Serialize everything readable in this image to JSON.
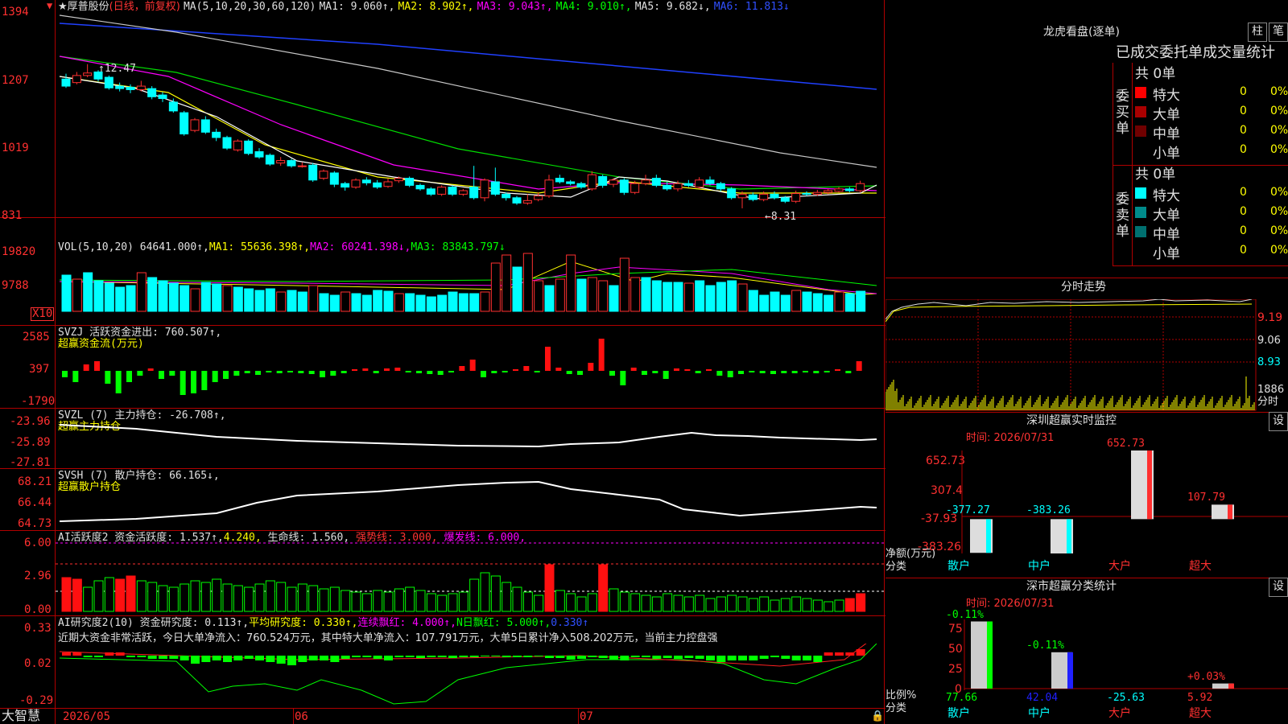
{
  "top_icon": "settings-marker-icon",
  "main": {
    "star_icon": "star-icon",
    "stock_name": "厚普股份",
    "mode": "(日线，前复权)",
    "ma_label": "MA(5,10,20,30,60,120)",
    "ma1": "MA1: 9.060↑,",
    "ma2": "MA2: 8.902↑,",
    "ma3": "MA3: 9.043↑,",
    "ma4": "MA4: 9.010↑,",
    "ma5": "MA5: 9.682↓,",
    "ma6": "MA6: 11.813↓",
    "y_ticks": [
      "1394",
      "1207",
      "1019",
      "831"
    ],
    "high_note": "12.47",
    "low_note": "←8.31"
  },
  "vol": {
    "label": "VOL(5,10,20)",
    "value": "64641.000↑,",
    "ma1": "MA1: 55636.398↑,",
    "ma2": "MA2: 60241.398↓,",
    "ma3": "MA3: 83843.797↓",
    "y_ticks": [
      "19820",
      "9788"
    ],
    "unit": "X10"
  },
  "svzj": {
    "label": "SVZJ  活跃资金进出: 760.507↑,",
    "sub": "超赢资金流(万元)",
    "y_ticks": [
      "2585",
      "397",
      "-1790"
    ]
  },
  "svzl": {
    "label": "SVZL (7) 主力持仓: -26.708↑,",
    "sub": "超赢主力持仓",
    "y_ticks": [
      "-23.96",
      "-25.89",
      "-27.81"
    ]
  },
  "svsh": {
    "label": "SVSH (7) 散户持仓: 66.165↓,",
    "sub": "超赢散户持仓",
    "y_ticks": [
      "68.21",
      "66.44",
      "64.73"
    ]
  },
  "ai1": {
    "label": "AI活跃度2 资金活跃度: 1.537↑,",
    "v2": "4.240,",
    "v3": "生命线: 1.560,",
    "v4": "强势线: 3.000,",
    "v5": "爆发线: 6.000,",
    "y_ticks": [
      "6.00",
      "2.96",
      "0.00"
    ]
  },
  "ai2": {
    "label": "AI研究度2(10) 资金研究度: 0.113↑,",
    "v2": "平均研究度: 0.330↑,",
    "v3": "连续飘红: 4.000↑,",
    "v4": "N日飘红: 5.000↑,",
    "v5": "0.330↑",
    "comment": "近期大资金非常活跃，今日大单净流入：760.524万元，其中特大单净流入：107.791万元，大单5日累计净入508.202万元，当前主力控盘强",
    "y_ticks": [
      "0.33",
      "0.02",
      "-0.29"
    ]
  },
  "footer": {
    "brand": "大智慧",
    "dates": [
      "2026/05",
      "06",
      "07"
    ],
    "lock_icon": "lock-icon"
  },
  "right": {
    "dragon_title": "龙虎看盘(逐单)",
    "btn_column": "柱",
    "btn_tick": "笔",
    "stat_title": "已成交委托单成交量统计",
    "buy_side": "委买单",
    "sell_side": "委卖单",
    "buy_total": "共 0单",
    "sell_total": "共 0单",
    "buy_rows": [
      {
        "name": "特大",
        "count": "0",
        "pct": "0%",
        "color": "#ff0000"
      },
      {
        "name": "大单",
        "count": "0",
        "pct": "0%",
        "color": "#aa0000"
      },
      {
        "name": "中单",
        "count": "0",
        "pct": "0%",
        "color": "#700000"
      },
      {
        "name": "小单",
        "count": "0",
        "pct": "0%",
        "color": "#000000"
      }
    ],
    "sell_rows": [
      {
        "name": "特大",
        "count": "0",
        "pct": "0%",
        "color": "#00ffff"
      },
      {
        "name": "大单",
        "count": "0",
        "pct": "0%",
        "color": "#008b8b"
      },
      {
        "name": "中单",
        "count": "0",
        "pct": "0%",
        "color": "#007070"
      },
      {
        "name": "小单",
        "count": "0",
        "pct": "0%",
        "color": "#000000"
      }
    ],
    "intraday_title": "分时走势",
    "intraday_ticks": [
      "9.19",
      "9.06",
      "8.93"
    ],
    "intraday_vol": "1886",
    "intraday_vol_unit": "分时",
    "monitor_title": "深圳超赢实时监控",
    "settings_label": "设",
    "monitor_time": "时间: 2026/07/31",
    "monitor_ticks": [
      "652.73",
      "307.4",
      "-37.93",
      "-383.26"
    ],
    "monitor_unit": "净额(万元)",
    "monitor_cat": "分类",
    "monitor_cats": [
      "散户",
      "中户",
      "大户",
      "超大"
    ],
    "monitor_values": [
      "-377.27",
      "-383.26",
      "652.73",
      "107.79"
    ],
    "class_title": "深市超赢分类统计",
    "class_time": "时间: 2026/07/31",
    "class_ticks": [
      "75",
      "50",
      "25",
      "0"
    ],
    "class_top": [
      "-0.11%",
      "-0.11%",
      "",
      "+0.03%"
    ],
    "class_bottom": [
      "77.66",
      "42.04",
      "-25.63",
      "5.92"
    ],
    "class_unit": "比例%",
    "class_cat": "分类",
    "class_cats": [
      "散户",
      "中户",
      "大户",
      "超大"
    ]
  },
  "chart_data": {
    "type": "candlestick",
    "x_labels": [
      "2026/05",
      "06",
      "07"
    ],
    "candles": [
      {
        "o": 1205,
        "c": 1185,
        "h": 1220,
        "l": 1180
      },
      {
        "o": 1195,
        "c": 1215,
        "h": 1225,
        "l": 1190
      },
      {
        "o": 1215,
        "c": 1222,
        "h": 1247,
        "l": 1210
      },
      {
        "o": 1225,
        "c": 1205,
        "h": 1230,
        "l": 1198
      },
      {
        "o": 1210,
        "c": 1180,
        "h": 1215,
        "l": 1175
      },
      {
        "o": 1185,
        "c": 1178,
        "h": 1195,
        "l": 1170
      },
      {
        "o": 1182,
        "c": 1175,
        "h": 1190,
        "l": 1165
      },
      {
        "o": 1175,
        "c": 1185,
        "h": 1200,
        "l": 1170
      },
      {
        "o": 1178,
        "c": 1155,
        "h": 1185,
        "l": 1148
      },
      {
        "o": 1160,
        "c": 1150,
        "h": 1168,
        "l": 1140
      },
      {
        "o": 1140,
        "c": 1115,
        "h": 1150,
        "l": 1110
      },
      {
        "o": 1110,
        "c": 1050,
        "h": 1115,
        "l": 1045
      },
      {
        "o": 1060,
        "c": 1090,
        "h": 1095,
        "l": 1055
      },
      {
        "o": 1090,
        "c": 1055,
        "h": 1100,
        "l": 1050
      },
      {
        "o": 1055,
        "c": 1040,
        "h": 1065,
        "l": 1030
      },
      {
        "o": 1040,
        "c": 1010,
        "h": 1045,
        "l": 1005
      },
      {
        "o": 1005,
        "c": 1030,
        "h": 1035,
        "l": 1000
      },
      {
        "o": 1030,
        "c": 995,
        "h": 1035,
        "l": 990
      },
      {
        "o": 1000,
        "c": 985,
        "h": 1010,
        "l": 980
      },
      {
        "o": 990,
        "c": 965,
        "h": 995,
        "l": 960
      },
      {
        "o": 968,
        "c": 975,
        "h": 985,
        "l": 960
      },
      {
        "o": 975,
        "c": 960,
        "h": 980,
        "l": 955
      },
      {
        "o": 960,
        "c": 960,
        "h": 970,
        "l": 955
      },
      {
        "o": 962,
        "c": 920,
        "h": 968,
        "l": 915
      },
      {
        "o": 925,
        "c": 945,
        "h": 950,
        "l": 920
      },
      {
        "o": 940,
        "c": 908,
        "h": 945,
        "l": 900
      },
      {
        "o": 910,
        "c": 900,
        "h": 915,
        "l": 890
      },
      {
        "o": 900,
        "c": 920,
        "h": 925,
        "l": 895
      },
      {
        "o": 920,
        "c": 912,
        "h": 928,
        "l": 905
      },
      {
        "o": 912,
        "c": 900,
        "h": 920,
        "l": 895
      },
      {
        "o": 902,
        "c": 915,
        "h": 925,
        "l": 898
      },
      {
        "o": 918,
        "c": 925,
        "h": 930,
        "l": 912
      },
      {
        "o": 925,
        "c": 905,
        "h": 930,
        "l": 900
      },
      {
        "o": 905,
        "c": 895,
        "h": 910,
        "l": 890
      },
      {
        "o": 895,
        "c": 880,
        "h": 900,
        "l": 875
      },
      {
        "o": 880,
        "c": 900,
        "h": 905,
        "l": 875
      },
      {
        "o": 900,
        "c": 880,
        "h": 905,
        "l": 875
      },
      {
        "o": 880,
        "c": 890,
        "h": 895,
        "l": 875
      },
      {
        "o": 900,
        "c": 870,
        "h": 960,
        "l": 865
      },
      {
        "o": 870,
        "c": 920,
        "h": 925,
        "l": 860
      },
      {
        "o": 915,
        "c": 880,
        "h": 955,
        "l": 875
      },
      {
        "o": 880,
        "c": 870,
        "h": 885,
        "l": 862
      },
      {
        "o": 870,
        "c": 855,
        "h": 875,
        "l": 850
      },
      {
        "o": 855,
        "c": 862,
        "h": 880,
        "l": 850
      },
      {
        "o": 865,
        "c": 875,
        "h": 885,
        "l": 860
      },
      {
        "o": 875,
        "c": 920,
        "h": 935,
        "l": 870
      },
      {
        "o": 925,
        "c": 915,
        "h": 935,
        "l": 910
      },
      {
        "o": 915,
        "c": 910,
        "h": 920,
        "l": 905
      },
      {
        "o": 910,
        "c": 900,
        "h": 915,
        "l": 895
      },
      {
        "o": 895,
        "c": 935,
        "h": 945,
        "l": 890
      },
      {
        "o": 930,
        "c": 905,
        "h": 935,
        "l": 898
      },
      {
        "o": 908,
        "c": 920,
        "h": 925,
        "l": 900
      },
      {
        "o": 920,
        "c": 885,
        "h": 925,
        "l": 878
      },
      {
        "o": 885,
        "c": 910,
        "h": 918,
        "l": 880
      },
      {
        "o": 910,
        "c": 920,
        "h": 935,
        "l": 905
      },
      {
        "o": 925,
        "c": 905,
        "h": 935,
        "l": 900
      },
      {
        "o": 905,
        "c": 895,
        "h": 915,
        "l": 890
      },
      {
        "o": 895,
        "c": 910,
        "h": 918,
        "l": 888
      },
      {
        "o": 910,
        "c": 905,
        "h": 920,
        "l": 900
      },
      {
        "o": 900,
        "c": 920,
        "h": 928,
        "l": 895
      },
      {
        "o": 920,
        "c": 910,
        "h": 930,
        "l": 905
      },
      {
        "o": 910,
        "c": 895,
        "h": 915,
        "l": 888
      },
      {
        "o": 895,
        "c": 870,
        "h": 900,
        "l": 865
      },
      {
        "o": 870,
        "c": 880,
        "h": 888,
        "l": 840
      },
      {
        "o": 878,
        "c": 865,
        "h": 885,
        "l": 860
      },
      {
        "o": 865,
        "c": 880,
        "h": 888,
        "l": 860
      },
      {
        "o": 880,
        "c": 870,
        "h": 888,
        "l": 865
      },
      {
        "o": 870,
        "c": 860,
        "h": 875,
        "l": 855
      },
      {
        "o": 860,
        "c": 882,
        "h": 890,
        "l": 855
      },
      {
        "o": 882,
        "c": 880,
        "h": 888,
        "l": 875
      },
      {
        "o": 880,
        "c": 885,
        "h": 892,
        "l": 875
      },
      {
        "o": 885,
        "c": 890,
        "h": 895,
        "l": 880
      },
      {
        "o": 888,
        "c": 895,
        "h": 900,
        "l": 885
      },
      {
        "o": 895,
        "c": 890,
        "h": 900,
        "l": 885
      },
      {
        "o": 890,
        "c": 910,
        "h": 918,
        "l": 885
      }
    ],
    "ylim": [
      831,
      1394
    ]
  }
}
